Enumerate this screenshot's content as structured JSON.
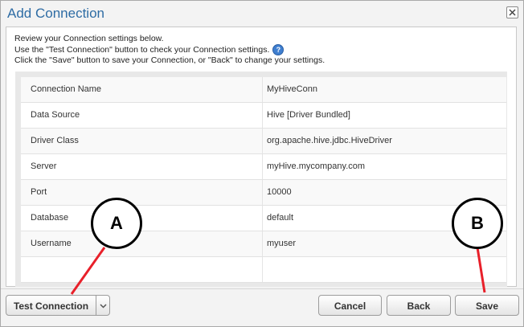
{
  "window": {
    "title": "Add Connection"
  },
  "instructions": {
    "line1": "Review your Connection settings below.",
    "line2": "Use the \"Test Connection\" button to check your Connection settings.",
    "line3": "Click the \"Save\" button to save your Connection, or \"Back\" to change your settings."
  },
  "settings": {
    "rows": [
      {
        "label": "Connection Name",
        "value": "MyHiveConn"
      },
      {
        "label": "Data Source",
        "value": "Hive [Driver Bundled]"
      },
      {
        "label": "Driver Class",
        "value": "org.apache.hive.jdbc.HiveDriver"
      },
      {
        "label": "Server",
        "value": "myHive.mycompany.com"
      },
      {
        "label": "Port",
        "value": "10000"
      },
      {
        "label": "Database",
        "value": "default"
      },
      {
        "label": "Username",
        "value": "myuser"
      },
      {
        "label": "",
        "value": ""
      }
    ]
  },
  "footer": {
    "test_connection_label": "Test Connection",
    "cancel_label": "Cancel",
    "back_label": "Back",
    "save_label": "Save"
  },
  "annotations": {
    "a_label": "A",
    "b_label": "B",
    "arrow_color": "#e8202a"
  },
  "colors": {
    "title": "#2e6ca4",
    "help_icon": "#3f7fd0"
  }
}
